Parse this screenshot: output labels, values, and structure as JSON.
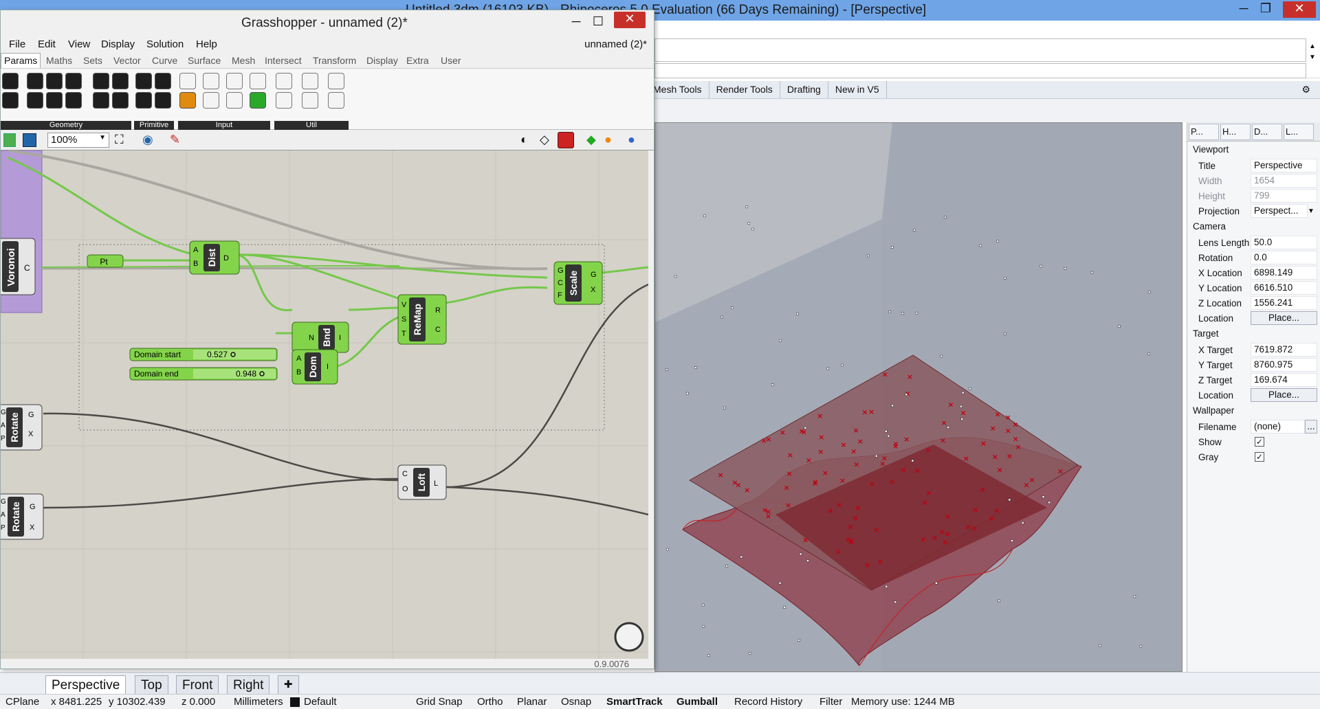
{
  "rhino": {
    "title": "Untitled.3dm (16103 KB) - Rhinoceros 5.0 Evaluation (66 Days Remaining) - [Perspective]",
    "tabs": [
      "Mesh Tools",
      "Render Tools",
      "Drafting",
      "New in V5"
    ],
    "viewport_tabs": [
      "Perspective",
      "Top",
      "Front",
      "Right"
    ],
    "props_tabs": [
      "P...",
      "H...",
      "D...",
      "L..."
    ],
    "props": {
      "viewport_heading": "Viewport",
      "title_label": "Title",
      "title_value": "Perspective",
      "width_label": "Width",
      "width_value": "1654",
      "height_label": "Height",
      "height_value": "799",
      "projection_label": "Projection",
      "projection_value": "Perspect...",
      "camera_heading": "Camera",
      "lens_label": "Lens Length",
      "lens_value": "50.0",
      "rotation_label": "Rotation",
      "rotation_value": "0.0",
      "xloc_label": "X Location",
      "xloc_value": "6898.149",
      "yloc_label": "Y Location",
      "yloc_value": "6616.510",
      "zloc_label": "Z Location",
      "zloc_value": "1556.241",
      "location_label": "Location",
      "place_label": "Place...",
      "target_heading": "Target",
      "xt_label": "X Target",
      "xt_value": "7619.872",
      "yt_label": "Y Target",
      "yt_value": "8760.975",
      "zt_label": "Z Target",
      "zt_value": "169.674",
      "wallpaper_heading": "Wallpaper",
      "filename_label": "Filename",
      "filename_value": "(none)",
      "browse_label": "...",
      "show_label": "Show",
      "gray_label": "Gray",
      "check_glyph": "✓"
    },
    "status": {
      "cplane": "CPlane",
      "x": "x 8481.225",
      "y": "y 10302.439",
      "z": "z 0.000",
      "units": "Millimeters",
      "layer": "Default",
      "grid_snap": "Grid Snap",
      "ortho": "Ortho",
      "planar": "Planar",
      "osnap": "Osnap",
      "smarttrack": "SmartTrack",
      "gumball": "Gumball",
      "record_history": "Record History",
      "filter": "Filter",
      "memory": "Memory use: 1244 MB"
    }
  },
  "grasshopper": {
    "title": "Grasshopper - unnamed (2)*",
    "menu": [
      "File",
      "Edit",
      "View",
      "Display",
      "Solution",
      "Help"
    ],
    "doc_name": "unnamed (2)*",
    "tabs": [
      "Params",
      "Maths",
      "Sets",
      "Vector",
      "Curve",
      "Surface",
      "Mesh",
      "Intersect",
      "Transform",
      "Display",
      "Extra",
      "User"
    ],
    "ribbon_groups": [
      "Geometry",
      "Primitive",
      "Input",
      "Util"
    ],
    "zoom": "100%",
    "version": "0.9.0076",
    "nodes": {
      "voronoi": {
        "name": "Voronoi",
        "out": "C"
      },
      "pt": {
        "name": "Pt"
      },
      "dist": {
        "name": "Dist",
        "in": [
          "A",
          "B"
        ],
        "out": "D"
      },
      "bnd": {
        "name": "Bnd",
        "in": "N",
        "out": "I"
      },
      "remap": {
        "name": "ReMap",
        "in": [
          "V",
          "S",
          "T"
        ],
        "out": [
          "R",
          "C"
        ]
      },
      "scale": {
        "name": "Scale",
        "in": [
          "G",
          "C",
          "F"
        ],
        "out": [
          "G",
          "X"
        ]
      },
      "dom": {
        "name": "Dom",
        "in": [
          "A",
          "B"
        ],
        "out": "I"
      },
      "rotate1": {
        "name": "Rotate",
        "in": [
          "G",
          "A",
          "P"
        ],
        "out": [
          "G",
          "X"
        ]
      },
      "rotate2": {
        "name": "Rotate",
        "in": [
          "G",
          "A",
          "P"
        ],
        "out": [
          "G",
          "X"
        ]
      },
      "loft": {
        "name": "Loft",
        "in": [
          "C",
          "O"
        ],
        "out": "L"
      }
    },
    "sliders": [
      {
        "label": "Domain start",
        "value": "0.527"
      },
      {
        "label": "Domain end",
        "value": "0.948"
      }
    ]
  }
}
